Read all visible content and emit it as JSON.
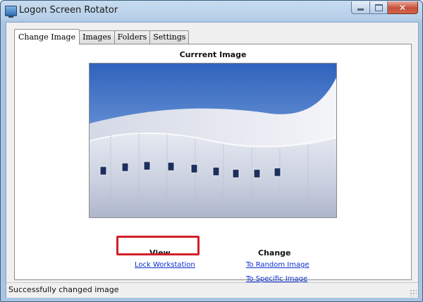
{
  "window": {
    "title": "Logon Screen Rotator",
    "icon": "monitor-icon",
    "controls": {
      "minimize": "minimize-icon",
      "maximize": "maximize-icon",
      "close": "✕"
    }
  },
  "tabs": [
    {
      "label": "Change Image",
      "active": true
    },
    {
      "label": "Images",
      "active": false
    },
    {
      "label": "Folders",
      "active": false
    },
    {
      "label": "Settings",
      "active": false
    }
  ],
  "main": {
    "current_image_title": "Currrent Image",
    "view": {
      "heading": "View",
      "links": [
        "Lock Workstation"
      ]
    },
    "change": {
      "heading": "Change",
      "links": [
        "To Random Image",
        "To Specific Image"
      ]
    }
  },
  "status": {
    "text": "Successfully changed image"
  },
  "colors": {
    "link": "#0b2fd0",
    "highlight": "#d2202a",
    "sky": "#3f73c9"
  }
}
